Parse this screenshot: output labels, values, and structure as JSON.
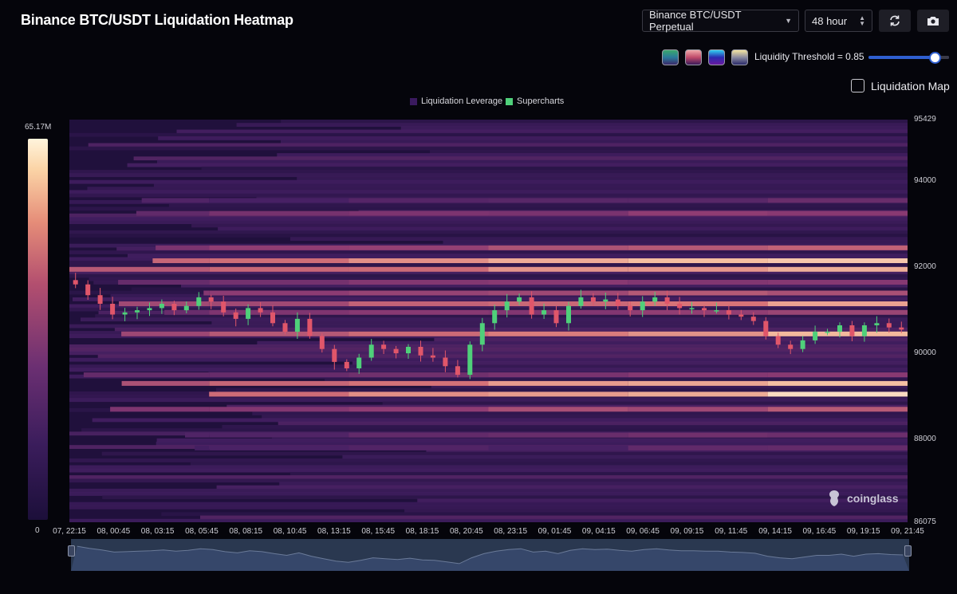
{
  "header": {
    "title": "Binance BTC/USDT Liquidation Heatmap",
    "pair_select": "Binance BTC/USDT Perpetual",
    "range_select": "48 hour"
  },
  "controls": {
    "threshold_label": "Liquidity Threshold = 0.85",
    "threshold_value": 0.85,
    "palettes": [
      "viridis",
      "magma",
      "rainbow",
      "cividis"
    ],
    "liquidation_map_label": "Liquidation Map",
    "liquidation_map_checked": false
  },
  "legend": {
    "items": [
      {
        "label": "Liquidation Leverage",
        "color": "#3a1a5e"
      },
      {
        "label": "Supercharts",
        "color": "#4fd07a"
      }
    ]
  },
  "color_scale": {
    "max_label": "65.17M",
    "min_label": "0"
  },
  "watermark": "coinglass",
  "chart_data": {
    "type": "heatmap",
    "y_ticks": [
      "95429",
      "94000",
      "92000",
      "90000",
      "88000",
      "86075"
    ],
    "ylim": [
      86075,
      95429
    ],
    "x_ticks": [
      "07, 22:15",
      "08, 00:45",
      "08, 03:15",
      "08, 05:45",
      "08, 08:15",
      "08, 10:45",
      "08, 13:15",
      "08, 15:45",
      "08, 18:15",
      "08, 20:45",
      "08, 23:15",
      "09, 01:45",
      "09, 04:15",
      "09, 06:45",
      "09, 09:15",
      "09, 11:45",
      "09, 14:15",
      "09, 16:45",
      "09, 19:15",
      "09, 21:45"
    ],
    "price_series": {
      "name": "Supercharts",
      "values": [
        91600,
        91350,
        91150,
        90900,
        90950,
        91000,
        91050,
        91150,
        91000,
        91100,
        91300,
        91200,
        90950,
        90800,
        91050,
        90950,
        90700,
        90500,
        90800,
        90400,
        90100,
        89800,
        89650,
        89900,
        90200,
        90100,
        90000,
        90150,
        89950,
        89900,
        89700,
        89500,
        90200,
        90700,
        91000,
        91200,
        91300,
        90900,
        91000,
        90700,
        91100,
        91300,
        91200,
        91250,
        91100,
        91000,
        91200,
        91300,
        91150,
        91050,
        91050,
        91000,
        91000,
        90900,
        90850,
        90750,
        90400,
        90200,
        90100,
        90300,
        90500,
        90500,
        90650,
        90400,
        90650,
        90700,
        90600,
        90550
      ]
    },
    "liquidation_bands": [
      {
        "price": 92450,
        "intensity": 0.75
      },
      {
        "price": 92150,
        "intensity": 1.0
      },
      {
        "price": 91950,
        "intensity": 0.95
      },
      {
        "price": 91650,
        "intensity": 0.6
      },
      {
        "price": 91400,
        "intensity": 0.7
      },
      {
        "price": 91150,
        "intensity": 0.85
      },
      {
        "price": 90950,
        "intensity": 0.65
      },
      {
        "price": 90450,
        "intensity": 0.9
      },
      {
        "price": 89500,
        "intensity": 0.6
      },
      {
        "price": 89300,
        "intensity": 0.95
      },
      {
        "price": 89050,
        "intensity": 0.98
      },
      {
        "price": 88700,
        "intensity": 0.7
      },
      {
        "price": 93250,
        "intensity": 0.6
      },
      {
        "price": 93550,
        "intensity": 0.45
      },
      {
        "price": 88100,
        "intensity": 0.5
      },
      {
        "price": 87800,
        "intensity": 0.4
      }
    ]
  }
}
